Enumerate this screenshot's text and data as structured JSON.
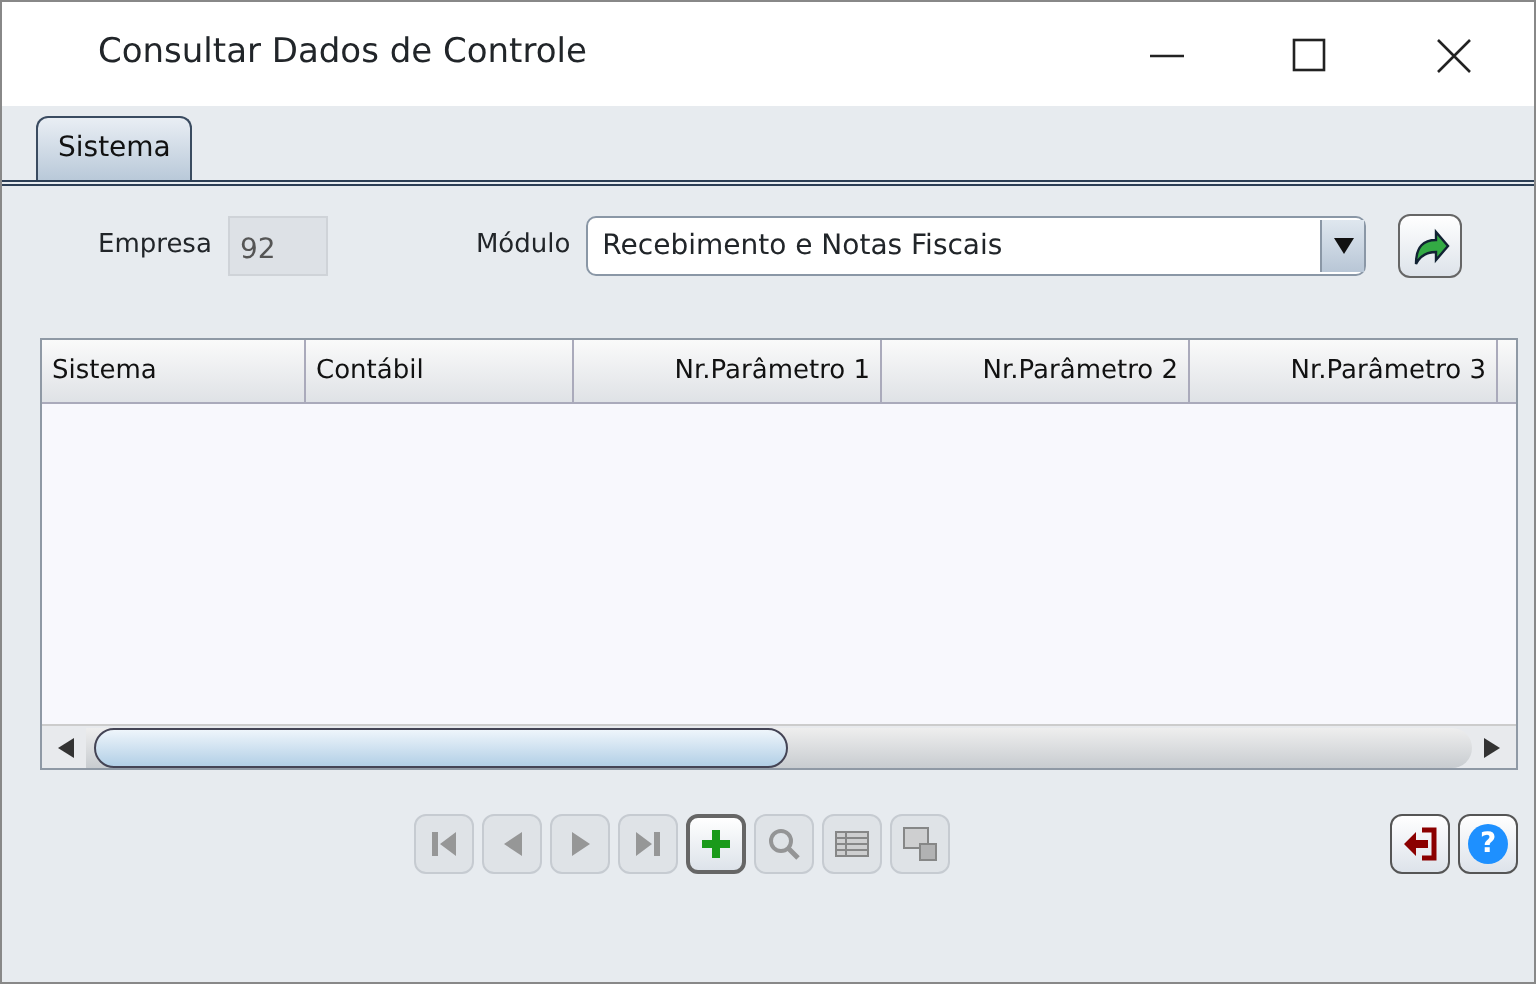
{
  "window": {
    "title": "Consultar Dados de Controle"
  },
  "tabs": [
    {
      "label": "Sistema",
      "selected": true
    }
  ],
  "form": {
    "empresa_label": "Empresa",
    "empresa_value": "92",
    "modulo_label": "Módulo",
    "modulo_value": "Recebimento e Notas Fiscais"
  },
  "table": {
    "columns": [
      {
        "label": "Sistema",
        "kind": "text"
      },
      {
        "label": "Contábil",
        "kind": "text"
      },
      {
        "label": "Nr.Parâmetro 1",
        "kind": "number"
      },
      {
        "label": "Nr.Parâmetro 2",
        "kind": "number"
      },
      {
        "label": "Nr.Parâmetro 3",
        "kind": "number"
      }
    ]
  },
  "toolbar": [
    {
      "kind": "first",
      "disabled": true,
      "focused": false
    },
    {
      "kind": "prev",
      "disabled": true,
      "focused": false
    },
    {
      "kind": "next",
      "disabled": true,
      "focused": false
    },
    {
      "kind": "last",
      "disabled": true,
      "focused": false
    },
    {
      "kind": "add",
      "disabled": false,
      "focused": true
    },
    {
      "kind": "search",
      "disabled": true,
      "focused": false
    },
    {
      "kind": "grid",
      "disabled": true,
      "focused": false
    },
    {
      "kind": "export",
      "disabled": true,
      "focused": false
    }
  ],
  "actions": [
    {
      "kind": "exit"
    },
    {
      "kind": "help",
      "glyph": "?"
    }
  ]
}
